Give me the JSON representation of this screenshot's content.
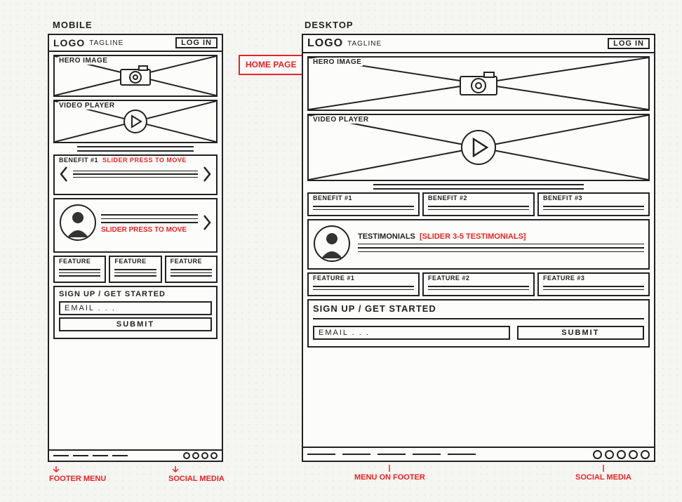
{
  "page_label": "HOME PAGE",
  "labels": {
    "mobile": "MOBILE",
    "desktop": "DESKTOP"
  },
  "header": {
    "logo": "LOGO",
    "tagline": "TAGLINE",
    "login": "LOG IN"
  },
  "sections": {
    "hero": "HERO IMAGE",
    "video": "VIDEO PLAYER",
    "testimonials": "TESTIMONIALS",
    "signup": "SIGN UP / GET STARTED"
  },
  "mobile": {
    "benefit": "BENEFIT #1",
    "slider_note": "SLIDER PRESS TO MOVE",
    "slider_note2": "SLIDER PRESS TO MOVE",
    "features": [
      "FEATURE",
      "FEATURE",
      "FEATURE"
    ]
  },
  "desktop": {
    "benefits": [
      "BENEFIT #1",
      "BENEFIT #2",
      "BENEFIT #3"
    ],
    "testimonials_note": "[SLIDER 3-5 TESTIMONIALS]",
    "features": [
      "FEATURE #1",
      "FEATURE #2",
      "FEATURE #3"
    ]
  },
  "form": {
    "email_placeholder": "EMAIL . . .",
    "submit": "SUBMIT"
  },
  "footer_annotations": {
    "mobile_menu": "FOOTER MENU",
    "mobile_social": "SOCIAL MEDIA",
    "desktop_menu": "MENU ON FOOTER",
    "desktop_social": "SOCIAL MEDIA"
  }
}
